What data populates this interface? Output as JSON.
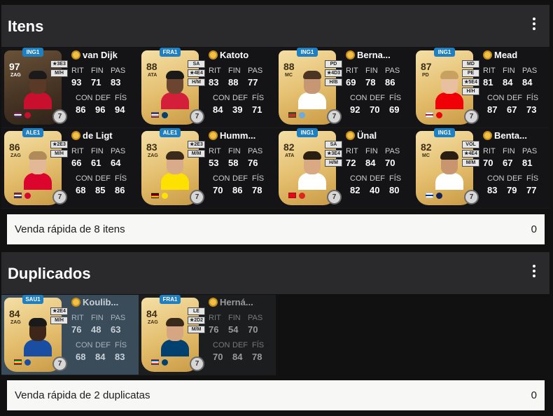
{
  "sections": [
    {
      "title": "Itens",
      "quick_sell_label": "Venda rápida de 8 itens",
      "quick_sell_value": "0"
    },
    {
      "title": "Duplicados",
      "quick_sell_label": "Venda rápida de 2 duplicatas",
      "quick_sell_value": "0"
    }
  ],
  "labels": {
    "rit": "RIT",
    "fin": "FIN",
    "pas": "PAS",
    "con": "CON",
    "def": "DEF",
    "fis": "FÍS"
  },
  "players": [
    {
      "name": "van Dijk",
      "rating": "97",
      "pos": "ZAG",
      "league": "ING1",
      "side1": "★3E3",
      "side2": "M/H",
      "chem": "7",
      "rit": "93",
      "fin": "71",
      "pas": "83",
      "con": "86",
      "def": "96",
      "fis": "94",
      "flag_colors": [
        "#ae1c28",
        "#ffffff",
        "#21468b"
      ],
      "club_color": "#c8102e",
      "skin": "#5a3a26",
      "hair": "#1a1a1a",
      "kit": "#c8102e"
    },
    {
      "name": "Katoto",
      "rating": "88",
      "pos": "ATA",
      "league": "FRA1",
      "side1": "SA",
      "side2": "★4E4",
      "side3": "H/M",
      "chem": "7",
      "rit": "83",
      "fin": "88",
      "pas": "77",
      "con": "84",
      "def": "39",
      "fis": "71",
      "flag_colors": [
        "#0055a4",
        "#ffffff",
        "#ef4135"
      ],
      "club_color": "#004170",
      "skin": "#6b4530",
      "hair": "#1a1a1a",
      "kit": "#d41f3a"
    },
    {
      "name": "Berna...",
      "rating": "88",
      "pos": "MC",
      "league": "ING1",
      "side1": "PD",
      "side2": "★4D3",
      "side3": "H/B",
      "chem": "7",
      "rit": "69",
      "fin": "78",
      "pas": "86",
      "con": "92",
      "def": "70",
      "fis": "69",
      "flag_colors": [
        "#046a38",
        "#da291c",
        "#da291c"
      ],
      "club_color": "#6cabdd",
      "skin": "#c79673",
      "hair": "#4a3424",
      "kit": "#ffffff"
    },
    {
      "name": "Mead",
      "rating": "87",
      "pos": "PD",
      "league": "ING1",
      "side1": "MD",
      "side2": "PE",
      "side3": "★5E4",
      "side4": "H/H",
      "chem": "7",
      "rit": "81",
      "fin": "84",
      "pas": "84",
      "con": "87",
      "def": "67",
      "fis": "73",
      "flag_colors": [
        "#ffffff",
        "#ce1124",
        "#ffffff"
      ],
      "club_color": "#ef0107",
      "skin": "#e8c0a0",
      "hair": "#c8a060",
      "kit": "#ef0107"
    },
    {
      "name": "de Ligt",
      "rating": "86",
      "pos": "ZAG",
      "league": "ALE1",
      "side1": "★2E3",
      "side2": "M/H",
      "chem": "7",
      "rit": "66",
      "fin": "61",
      "pas": "64",
      "con": "68",
      "def": "85",
      "fis": "86",
      "flag_colors": [
        "#ae1c28",
        "#ffffff",
        "#21468b"
      ],
      "club_color": "#dc052d",
      "skin": "#e2b896",
      "hair": "#b08a58",
      "kit": "#dc052d"
    },
    {
      "name": "Humm...",
      "rating": "83",
      "pos": "ZAG",
      "league": "ALE1",
      "side1": "★2E3",
      "side2": "M/M",
      "chem": "7",
      "rit": "53",
      "fin": "58",
      "pas": "76",
      "con": "70",
      "def": "86",
      "fis": "78",
      "flag_colors": [
        "#000000",
        "#dd0000",
        "#ffce00"
      ],
      "club_color": "#fde100",
      "skin": "#d9ab88",
      "hair": "#3a2a1c",
      "kit": "#fde100"
    },
    {
      "name": "Ünal",
      "rating": "82",
      "pos": "ATA",
      "league": "ING1",
      "side1": "SA",
      "side2": "★3E4",
      "side3": "H/M",
      "chem": "7",
      "rit": "72",
      "fin": "84",
      "pas": "70",
      "con": "82",
      "def": "40",
      "fis": "80",
      "flag_colors": [
        "#e30a17",
        "#e30a17",
        "#e30a17"
      ],
      "club_color": "#da291c",
      "skin": "#d8a983",
      "hair": "#2a1d12",
      "kit": "#ffffff"
    },
    {
      "name": "Benta...",
      "rating": "82",
      "pos": "MC",
      "league": "ING1",
      "side1": "VOL",
      "side2": "★4E4",
      "side3": "M/M",
      "chem": "7",
      "rit": "70",
      "fin": "67",
      "pas": "81",
      "con": "83",
      "def": "79",
      "fis": "77",
      "flag_colors": [
        "#ffffff",
        "#0038a8",
        "#ffffff"
      ],
      "club_color": "#132257",
      "skin": "#c9956e",
      "hair": "#2a1d12",
      "kit": "#ffffff"
    },
    {
      "name": "Koulib...",
      "rating": "84",
      "pos": "ZAG",
      "league": "SAU1",
      "side1": "★2E4",
      "side2": "M/H",
      "chem": "7",
      "rit": "76",
      "fin": "48",
      "pas": "63",
      "con": "68",
      "def": "84",
      "fis": "83",
      "flag_colors": [
        "#00853f",
        "#fdef42",
        "#e31b23"
      ],
      "club_color": "#1a4ea2",
      "skin": "#3e2618",
      "hair": "#1a1a1a",
      "kit": "#1a4ea2"
    },
    {
      "name": "Herná...",
      "rating": "84",
      "pos": "ZAG",
      "league": "FRA1",
      "side1": "LE",
      "side2": "★2D2",
      "side3": "M/M",
      "chem": "7",
      "rit": "76",
      "fin": "54",
      "pas": "70",
      "con": "70",
      "def": "84",
      "fis": "78",
      "flag_colors": [
        "#0055a4",
        "#ffffff",
        "#ef4135"
      ],
      "club_color": "#004170",
      "skin": "#d6a682",
      "hair": "#3a2a1c",
      "kit": "#004170"
    }
  ]
}
